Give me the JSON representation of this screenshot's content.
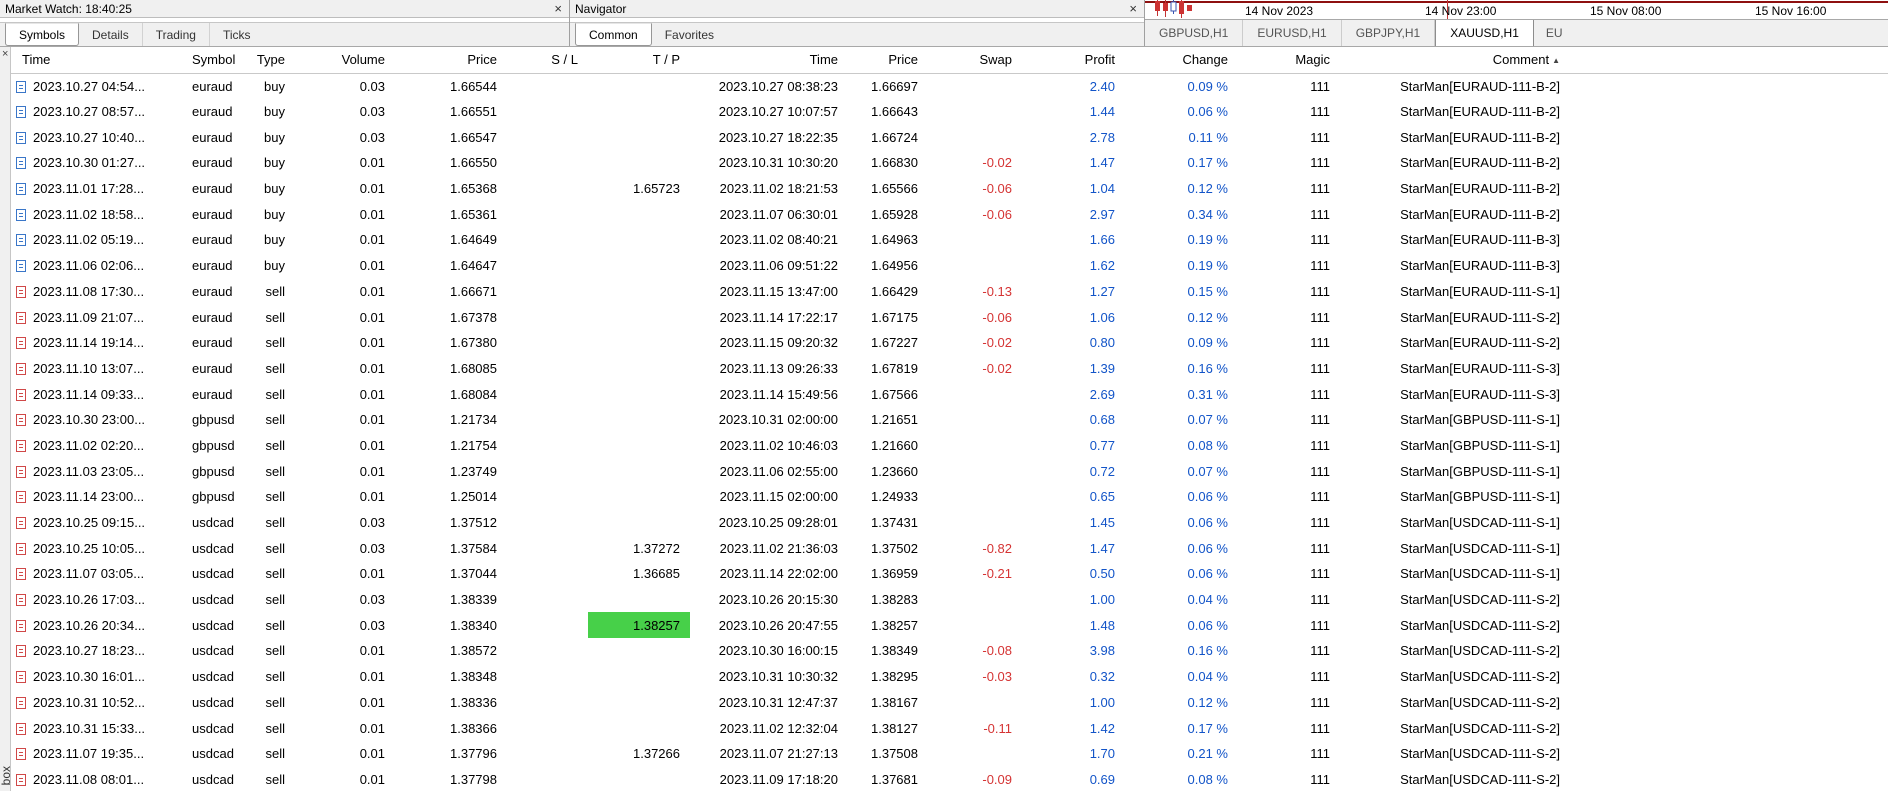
{
  "colors": {
    "profit_blue": "#1254c8",
    "negative_red": "#d53434",
    "highlight_green": "#47d049",
    "buy_icon_blue": "#3a76c8",
    "sell_icon_red": "#d04848",
    "chart_line_dark_red": "#8e1010"
  },
  "market_watch": {
    "title": "Market Watch: 18:40:25",
    "close_icon": "×",
    "tabs": [
      "Symbols",
      "Details",
      "Trading",
      "Ticks"
    ],
    "active_tab": "Symbols"
  },
  "navigator": {
    "title": "Navigator",
    "close_icon": "×",
    "tabs": [
      "Common",
      "Favorites"
    ],
    "active_tab": "Common"
  },
  "chart": {
    "time_labels": [
      "14 Nov 2023",
      "14 Nov 23:00",
      "15 Nov 08:00",
      "15 Nov 16:00"
    ],
    "tabs": [
      "GBPUSD,H1",
      "EURUSD,H1",
      "GBPJPY,H1",
      "XAUUSD,H1",
      "EU"
    ],
    "active_tab": "XAUUSD,H1"
  },
  "toolbox": {
    "close_icon": "×",
    "vertical_label": "box",
    "sort_icon": "▲"
  },
  "table": {
    "columns": [
      "Time",
      "Symbol",
      "Type",
      "Volume",
      "Price",
      "S / L",
      "T / P",
      "Time",
      "Price",
      "Swap",
      "Profit",
      "Change",
      "Magic",
      "Comment"
    ],
    "sorted_column": "Comment",
    "rows": [
      {
        "type": "buy",
        "open_time": "2023.10.27 04:54...",
        "symbol": "euraud",
        "volume": "0.03",
        "open_price": "1.66544",
        "sl": "",
        "tp": "",
        "close_time": "2023.10.27 08:38:23",
        "close_price": "1.66697",
        "swap": "",
        "profit": "2.40",
        "change": "0.09 %",
        "magic": "111",
        "comment": "StarMan[EURAUD-111-B-2]"
      },
      {
        "type": "buy",
        "open_time": "2023.10.27 08:57...",
        "symbol": "euraud",
        "volume": "0.03",
        "open_price": "1.66551",
        "sl": "",
        "tp": "",
        "close_time": "2023.10.27 10:07:57",
        "close_price": "1.66643",
        "swap": "",
        "profit": "1.44",
        "change": "0.06 %",
        "magic": "111",
        "comment": "StarMan[EURAUD-111-B-2]"
      },
      {
        "type": "buy",
        "open_time": "2023.10.27 10:40...",
        "symbol": "euraud",
        "volume": "0.03",
        "open_price": "1.66547",
        "sl": "",
        "tp": "",
        "close_time": "2023.10.27 18:22:35",
        "close_price": "1.66724",
        "swap": "",
        "profit": "2.78",
        "change": "0.11 %",
        "magic": "111",
        "comment": "StarMan[EURAUD-111-B-2]"
      },
      {
        "type": "buy",
        "open_time": "2023.10.30 01:27...",
        "symbol": "euraud",
        "volume": "0.01",
        "open_price": "1.66550",
        "sl": "",
        "tp": "",
        "close_time": "2023.10.31 10:30:20",
        "close_price": "1.66830",
        "swap": "-0.02",
        "profit": "1.47",
        "change": "0.17 %",
        "magic": "111",
        "comment": "StarMan[EURAUD-111-B-2]"
      },
      {
        "type": "buy",
        "open_time": "2023.11.01 17:28...",
        "symbol": "euraud",
        "volume": "0.01",
        "open_price": "1.65368",
        "sl": "",
        "tp": "1.65723",
        "close_time": "2023.11.02 18:21:53",
        "close_price": "1.65566",
        "swap": "-0.06",
        "profit": "1.04",
        "change": "0.12 %",
        "magic": "111",
        "comment": "StarMan[EURAUD-111-B-2]"
      },
      {
        "type": "buy",
        "open_time": "2023.11.02 18:58...",
        "symbol": "euraud",
        "volume": "0.01",
        "open_price": "1.65361",
        "sl": "",
        "tp": "",
        "close_time": "2023.11.07 06:30:01",
        "close_price": "1.65928",
        "swap": "-0.06",
        "profit": "2.97",
        "change": "0.34 %",
        "magic": "111",
        "comment": "StarMan[EURAUD-111-B-2]"
      },
      {
        "type": "buy",
        "open_time": "2023.11.02 05:19...",
        "symbol": "euraud",
        "volume": "0.01",
        "open_price": "1.64649",
        "sl": "",
        "tp": "",
        "close_time": "2023.11.02 08:40:21",
        "close_price": "1.64963",
        "swap": "",
        "profit": "1.66",
        "change": "0.19 %",
        "magic": "111",
        "comment": "StarMan[EURAUD-111-B-3]"
      },
      {
        "type": "buy",
        "open_time": "2023.11.06 02:06...",
        "symbol": "euraud",
        "volume": "0.01",
        "open_price": "1.64647",
        "sl": "",
        "tp": "",
        "close_time": "2023.11.06 09:51:22",
        "close_price": "1.64956",
        "swap": "",
        "profit": "1.62",
        "change": "0.19 %",
        "magic": "111",
        "comment": "StarMan[EURAUD-111-B-3]"
      },
      {
        "type": "sell",
        "open_time": "2023.11.08 17:30...",
        "symbol": "euraud",
        "volume": "0.01",
        "open_price": "1.66671",
        "sl": "",
        "tp": "",
        "close_time": "2023.11.15 13:47:00",
        "close_price": "1.66429",
        "swap": "-0.13",
        "profit": "1.27",
        "change": "0.15 %",
        "magic": "111",
        "comment": "StarMan[EURAUD-111-S-1]"
      },
      {
        "type": "sell",
        "open_time": "2023.11.09 21:07...",
        "symbol": "euraud",
        "volume": "0.01",
        "open_price": "1.67378",
        "sl": "",
        "tp": "",
        "close_time": "2023.11.14 17:22:17",
        "close_price": "1.67175",
        "swap": "-0.06",
        "profit": "1.06",
        "change": "0.12 %",
        "magic": "111",
        "comment": "StarMan[EURAUD-111-S-2]"
      },
      {
        "type": "sell",
        "open_time": "2023.11.14 19:14...",
        "symbol": "euraud",
        "volume": "0.01",
        "open_price": "1.67380",
        "sl": "",
        "tp": "",
        "close_time": "2023.11.15 09:20:32",
        "close_price": "1.67227",
        "swap": "-0.02",
        "profit": "0.80",
        "change": "0.09 %",
        "magic": "111",
        "comment": "StarMan[EURAUD-111-S-2]"
      },
      {
        "type": "sell",
        "open_time": "2023.11.10 13:07...",
        "symbol": "euraud",
        "volume": "0.01",
        "open_price": "1.68085",
        "sl": "",
        "tp": "",
        "close_time": "2023.11.13 09:26:33",
        "close_price": "1.67819",
        "swap": "-0.02",
        "profit": "1.39",
        "change": "0.16 %",
        "magic": "111",
        "comment": "StarMan[EURAUD-111-S-3]"
      },
      {
        "type": "sell",
        "open_time": "2023.11.14 09:33...",
        "symbol": "euraud",
        "volume": "0.01",
        "open_price": "1.68084",
        "sl": "",
        "tp": "",
        "close_time": "2023.11.14 15:49:56",
        "close_price": "1.67566",
        "swap": "",
        "profit": "2.69",
        "change": "0.31 %",
        "magic": "111",
        "comment": "StarMan[EURAUD-111-S-3]"
      },
      {
        "type": "sell",
        "open_time": "2023.10.30 23:00...",
        "symbol": "gbpusd",
        "volume": "0.01",
        "open_price": "1.21734",
        "sl": "",
        "tp": "",
        "close_time": "2023.10.31 02:00:00",
        "close_price": "1.21651",
        "swap": "",
        "profit": "0.68",
        "change": "0.07 %",
        "magic": "111",
        "comment": "StarMan[GBPUSD-111-S-1]"
      },
      {
        "type": "sell",
        "open_time": "2023.11.02 02:20...",
        "symbol": "gbpusd",
        "volume": "0.01",
        "open_price": "1.21754",
        "sl": "",
        "tp": "",
        "close_time": "2023.11.02 10:46:03",
        "close_price": "1.21660",
        "swap": "",
        "profit": "0.77",
        "change": "0.08 %",
        "magic": "111",
        "comment": "StarMan[GBPUSD-111-S-1]"
      },
      {
        "type": "sell",
        "open_time": "2023.11.03 23:05...",
        "symbol": "gbpusd",
        "volume": "0.01",
        "open_price": "1.23749",
        "sl": "",
        "tp": "",
        "close_time": "2023.11.06 02:55:00",
        "close_price": "1.23660",
        "swap": "",
        "profit": "0.72",
        "change": "0.07 %",
        "magic": "111",
        "comment": "StarMan[GBPUSD-111-S-1]"
      },
      {
        "type": "sell",
        "open_time": "2023.11.14 23:00...",
        "symbol": "gbpusd",
        "volume": "0.01",
        "open_price": "1.25014",
        "sl": "",
        "tp": "",
        "close_time": "2023.11.15 02:00:00",
        "close_price": "1.24933",
        "swap": "",
        "profit": "0.65",
        "change": "0.06 %",
        "magic": "111",
        "comment": "StarMan[GBPUSD-111-S-1]"
      },
      {
        "type": "sell",
        "open_time": "2023.10.25 09:15...",
        "symbol": "usdcad",
        "volume": "0.03",
        "open_price": "1.37512",
        "sl": "",
        "tp": "",
        "close_time": "2023.10.25 09:28:01",
        "close_price": "1.37431",
        "swap": "",
        "profit": "1.45",
        "change": "0.06 %",
        "magic": "111",
        "comment": "StarMan[USDCAD-111-S-1]"
      },
      {
        "type": "sell",
        "open_time": "2023.10.25 10:05...",
        "symbol": "usdcad",
        "volume": "0.03",
        "open_price": "1.37584",
        "sl": "",
        "tp": "1.37272",
        "close_time": "2023.11.02 21:36:03",
        "close_price": "1.37502",
        "swap": "-0.82",
        "profit": "1.47",
        "change": "0.06 %",
        "magic": "111",
        "comment": "StarMan[USDCAD-111-S-1]"
      },
      {
        "type": "sell",
        "open_time": "2023.11.07 03:05...",
        "symbol": "usdcad",
        "volume": "0.01",
        "open_price": "1.37044",
        "sl": "",
        "tp": "1.36685",
        "close_time": "2023.11.14 22:02:00",
        "close_price": "1.36959",
        "swap": "-0.21",
        "profit": "0.50",
        "change": "0.06 %",
        "magic": "111",
        "comment": "StarMan[USDCAD-111-S-1]"
      },
      {
        "type": "sell",
        "open_time": "2023.10.26 17:03...",
        "symbol": "usdcad",
        "volume": "0.03",
        "open_price": "1.38339",
        "sl": "",
        "tp": "",
        "close_time": "2023.10.26 20:15:30",
        "close_price": "1.38283",
        "swap": "",
        "profit": "1.00",
        "change": "0.04 %",
        "magic": "111",
        "comment": "StarMan[USDCAD-111-S-2]"
      },
      {
        "type": "sell",
        "open_time": "2023.10.26 20:34...",
        "symbol": "usdcad",
        "volume": "0.03",
        "open_price": "1.38340",
        "sl": "",
        "tp": "1.38257",
        "tp_highlight": true,
        "close_time": "2023.10.26 20:47:55",
        "close_price": "1.38257",
        "swap": "",
        "profit": "1.48",
        "change": "0.06 %",
        "magic": "111",
        "comment": "StarMan[USDCAD-111-S-2]"
      },
      {
        "type": "sell",
        "open_time": "2023.10.27 18:23...",
        "symbol": "usdcad",
        "volume": "0.01",
        "open_price": "1.38572",
        "sl": "",
        "tp": "",
        "close_time": "2023.10.30 16:00:15",
        "close_price": "1.38349",
        "swap": "-0.08",
        "profit": "3.98",
        "change": "0.16 %",
        "magic": "111",
        "comment": "StarMan[USDCAD-111-S-2]"
      },
      {
        "type": "sell",
        "open_time": "2023.10.30 16:01...",
        "symbol": "usdcad",
        "volume": "0.01",
        "open_price": "1.38348",
        "sl": "",
        "tp": "",
        "close_time": "2023.10.31 10:30:32",
        "close_price": "1.38295",
        "swap": "-0.03",
        "profit": "0.32",
        "change": "0.04 %",
        "magic": "111",
        "comment": "StarMan[USDCAD-111-S-2]"
      },
      {
        "type": "sell",
        "open_time": "2023.10.31 10:52...",
        "symbol": "usdcad",
        "volume": "0.01",
        "open_price": "1.38336",
        "sl": "",
        "tp": "",
        "close_time": "2023.10.31 12:47:37",
        "close_price": "1.38167",
        "swap": "",
        "profit": "1.00",
        "change": "0.12 %",
        "magic": "111",
        "comment": "StarMan[USDCAD-111-S-2]"
      },
      {
        "type": "sell",
        "open_time": "2023.10.31 15:33...",
        "symbol": "usdcad",
        "volume": "0.01",
        "open_price": "1.38366",
        "sl": "",
        "tp": "",
        "close_time": "2023.11.02 12:32:04",
        "close_price": "1.38127",
        "swap": "-0.11",
        "profit": "1.42",
        "change": "0.17 %",
        "magic": "111",
        "comment": "StarMan[USDCAD-111-S-2]"
      },
      {
        "type": "sell",
        "open_time": "2023.11.07 19:35...",
        "symbol": "usdcad",
        "volume": "0.01",
        "open_price": "1.37796",
        "sl": "",
        "tp": "1.37266",
        "close_time": "2023.11.07 21:27:13",
        "close_price": "1.37508",
        "swap": "",
        "profit": "1.70",
        "change": "0.21 %",
        "magic": "111",
        "comment": "StarMan[USDCAD-111-S-2]"
      },
      {
        "type": "sell",
        "open_time": "2023.11.08 08:01...",
        "symbol": "usdcad",
        "volume": "0.01",
        "open_price": "1.37798",
        "sl": "",
        "tp": "",
        "close_time": "2023.11.09 17:18:20",
        "close_price": "1.37681",
        "swap": "-0.09",
        "profit": "0.69",
        "change": "0.08 %",
        "magic": "111",
        "comment": "StarMan[USDCAD-111-S-2]"
      }
    ]
  }
}
